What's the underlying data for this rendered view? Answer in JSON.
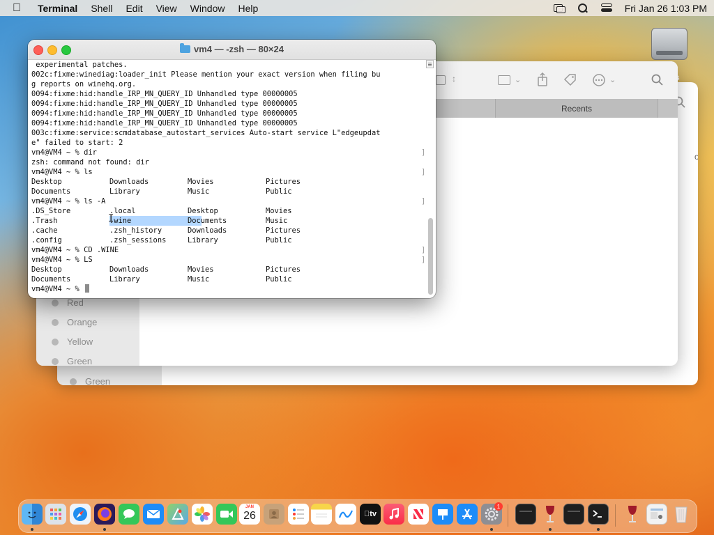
{
  "menubar": {
    "app_name": "Terminal",
    "menus": [
      "Shell",
      "Edit",
      "View",
      "Window",
      "Help"
    ],
    "clock": "Fri Jan 26  1:03 PM"
  },
  "desktop": {
    "drive_label_fragment": "s"
  },
  "finder": {
    "tab_label": "Recents",
    "tags": [
      "Red",
      "Orange",
      "Yellow",
      "Green"
    ],
    "back_tag": "Green",
    "side_text_fragment": "o"
  },
  "terminal": {
    "title": "vm4 — -zsh — 80×24",
    "lines": [
      " experimental patches.",
      "002c:fixme:winediag:loader_init Please mention your exact version when filing bu",
      "g reports on winehq.org.",
      "0094:fixme:hid:handle_IRP_MN_QUERY_ID Unhandled type 00000005",
      "0094:fixme:hid:handle_IRP_MN_QUERY_ID Unhandled type 00000005",
      "0094:fixme:hid:handle_IRP_MN_QUERY_ID Unhandled type 00000005",
      "0094:fixme:hid:handle_IRP_MN_QUERY_ID Unhandled type 00000005",
      "003c:fixme:service:scmdatabase_autostart_services Auto-start service L\"edgeupdat",
      "e\" failed to start: 2"
    ],
    "prompt_dir": "vm4@VM4 ~ % dir",
    "error_dir": "zsh: command not found: dir",
    "prompt_ls": "vm4@VM4 ~ % ls",
    "ls_row1": [
      "Desktop",
      "Downloads",
      "Movies",
      "Pictures"
    ],
    "ls_row2": [
      "Documents",
      "Library",
      "Music",
      "Public"
    ],
    "prompt_lsa": "vm4@VM4 ~ % ls -A",
    "lsa_row1": [
      ".DS_Store",
      ".local",
      "Desktop",
      "Movies"
    ],
    "lsa_row2": [
      ".Trash",
      ".wine",
      "Documents",
      "Music"
    ],
    "lsa_row3": [
      ".cache",
      ".zsh_history",
      "Downloads",
      "Pictures"
    ],
    "lsa_row4": [
      ".config",
      ".zsh_sessions",
      "Library",
      "Public"
    ],
    "prompt_cd": "vm4@VM4 ~ % CD .WINE",
    "prompt_LS": "vm4@VM4 ~ % LS",
    "LS_row1": [
      "Desktop",
      "Downloads",
      "Movies",
      "Pictures"
    ],
    "LS_row2": [
      "Documents",
      "Library",
      "Music",
      "Public"
    ],
    "current_prompt": "vm4@VM4 ~ % "
  },
  "dock": {
    "calendar_month": "JAN",
    "calendar_day": "26",
    "tv_label": "tv",
    "settings_badge": "1"
  }
}
